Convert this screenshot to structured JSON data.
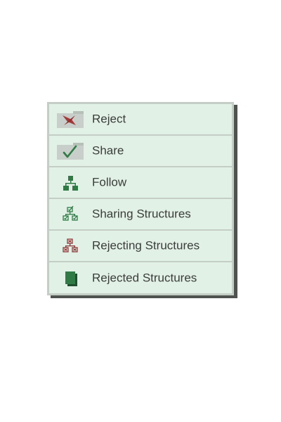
{
  "menu": {
    "items": [
      {
        "label": "Reject",
        "icon": "reject-folder-icon"
      },
      {
        "label": "Share",
        "icon": "share-folder-icon"
      },
      {
        "label": "Follow",
        "icon": "follow-structure-icon"
      },
      {
        "label": "Sharing Structures",
        "icon": "sharing-structures-icon"
      },
      {
        "label": "Rejecting Structures",
        "icon": "rejecting-structures-icon"
      },
      {
        "label": "Rejected Structures",
        "icon": "rejected-structures-icon"
      }
    ]
  },
  "colors": {
    "menu_background": "#e2f1e6",
    "border": "#c4cec7",
    "shadow": "#4e5350",
    "text": "#3a3d3b",
    "reject_red": "#a33a3a",
    "structure_green": "#2f7a45",
    "structure_red": "#8e3a3a"
  }
}
